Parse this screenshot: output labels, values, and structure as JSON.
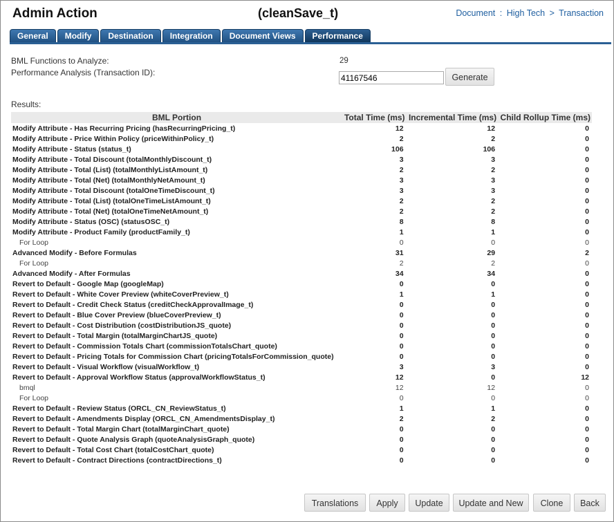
{
  "header": {
    "title": "Admin Action",
    "subtitle": "(cleanSave_t)",
    "breadcrumb": {
      "part1": "Document",
      "sep1": ":",
      "part2": "High Tech",
      "sep2": ">",
      "part3": "Transaction"
    }
  },
  "tabs": [
    "General",
    "Modify",
    "Destination",
    "Integration",
    "Document Views",
    "Performance"
  ],
  "form": {
    "bml_label": "BML Functions to Analyze:",
    "bml_count": "29",
    "perf_label": "Performance Analysis (Transaction ID):",
    "txn_id": "41167546",
    "generate_label": "Generate",
    "results_label": "Results:"
  },
  "table": {
    "headers": [
      "BML Portion",
      "Total Time (ms)",
      "Incremental Time (ms)",
      "Child Rollup Time (ms)"
    ],
    "rows": [
      {
        "level": 0,
        "portion": "Modify Attribute - Has Recurring Pricing (hasRecurringPricing_t)",
        "total": "12",
        "incremental": "12",
        "child": "0"
      },
      {
        "level": 0,
        "portion": "Modify Attribute - Price Within Policy (priceWithinPolicy_t)",
        "total": "2",
        "incremental": "2",
        "child": "0"
      },
      {
        "level": 0,
        "portion": "Modify Attribute - Status (status_t)",
        "total": "106",
        "incremental": "106",
        "child": "0"
      },
      {
        "level": 0,
        "portion": "Modify Attribute - Total Discount (totalMonthlyDiscount_t)",
        "total": "3",
        "incremental": "3",
        "child": "0"
      },
      {
        "level": 0,
        "portion": "Modify Attribute - Total (List) (totalMonthlyListAmount_t)",
        "total": "2",
        "incremental": "2",
        "child": "0"
      },
      {
        "level": 0,
        "portion": "Modify Attribute - Total (Net) (totalMonthlyNetAmount_t)",
        "total": "3",
        "incremental": "3",
        "child": "0"
      },
      {
        "level": 0,
        "portion": "Modify Attribute - Total Discount (totalOneTimeDiscount_t)",
        "total": "3",
        "incremental": "3",
        "child": "0"
      },
      {
        "level": 0,
        "portion": "Modify Attribute - Total (List) (totalOneTimeListAmount_t)",
        "total": "2",
        "incremental": "2",
        "child": "0"
      },
      {
        "level": 0,
        "portion": "Modify Attribute - Total (Net) (totalOneTimeNetAmount_t)",
        "total": "2",
        "incremental": "2",
        "child": "0"
      },
      {
        "level": 0,
        "portion": "Modify Attribute - Status (OSC) (statusOSC_t)",
        "total": "8",
        "incremental": "8",
        "child": "0"
      },
      {
        "level": 0,
        "portion": "Modify Attribute - Product Family (productFamily_t)",
        "total": "1",
        "incremental": "1",
        "child": "0"
      },
      {
        "level": 1,
        "portion": "For Loop",
        "total": "0",
        "incremental": "0",
        "child": "0"
      },
      {
        "level": 0,
        "portion": "Advanced Modify - Before Formulas",
        "total": "31",
        "incremental": "29",
        "child": "2"
      },
      {
        "level": 1,
        "portion": "For Loop",
        "total": "2",
        "incremental": "2",
        "child": "0"
      },
      {
        "level": 0,
        "portion": "Advanced Modify - After Formulas",
        "total": "34",
        "incremental": "34",
        "child": "0"
      },
      {
        "level": 0,
        "portion": "Revert to Default - Google Map (googleMap)",
        "total": "0",
        "incremental": "0",
        "child": "0"
      },
      {
        "level": 0,
        "portion": "Revert to Default - White Cover Preview (whiteCoverPreview_t)",
        "total": "1",
        "incremental": "1",
        "child": "0"
      },
      {
        "level": 0,
        "portion": "Revert to Default - Credit Check Status (creditCheckApprovalImage_t)",
        "total": "0",
        "incremental": "0",
        "child": "0"
      },
      {
        "level": 0,
        "portion": "Revert to Default - Blue Cover Preview (blueCoverPreview_t)",
        "total": "0",
        "incremental": "0",
        "child": "0"
      },
      {
        "level": 0,
        "portion": "Revert to Default - Cost Distribution (costDistributionJS_quote)",
        "total": "0",
        "incremental": "0",
        "child": "0"
      },
      {
        "level": 0,
        "portion": "Revert to Default - Total Margin (totalMarginChartJS_quote)",
        "total": "0",
        "incremental": "0",
        "child": "0"
      },
      {
        "level": 0,
        "portion": "Revert to Default - Commission Totals Chart (commissionTotalsChart_quote)",
        "total": "0",
        "incremental": "0",
        "child": "0"
      },
      {
        "level": 0,
        "portion": "Revert to Default - Pricing Totals for Commission Chart (pricingTotalsForCommission_quote)",
        "total": "0",
        "incremental": "0",
        "child": "0"
      },
      {
        "level": 0,
        "portion": "Revert to Default - Visual Workflow (visualWorkflow_t)",
        "total": "3",
        "incremental": "3",
        "child": "0"
      },
      {
        "level": 0,
        "portion": "Revert to Default - Approval Workflow Status (approvalWorkflowStatus_t)",
        "total": "12",
        "incremental": "0",
        "child": "12"
      },
      {
        "level": 1,
        "portion": "bmql",
        "total": "12",
        "incremental": "12",
        "child": "0"
      },
      {
        "level": 1,
        "portion": "For Loop",
        "total": "0",
        "incremental": "0",
        "child": "0"
      },
      {
        "level": 0,
        "portion": "Revert to Default - Review Status (ORCL_CN_ReviewStatus_t)",
        "total": "1",
        "incremental": "1",
        "child": "0"
      },
      {
        "level": 0,
        "portion": "Revert to Default - Amendments Display (ORCL_CN_AmendmentsDisplay_t)",
        "total": "2",
        "incremental": "2",
        "child": "0"
      },
      {
        "level": 0,
        "portion": "Revert to Default - Total Margin Chart (totalMarginChart_quote)",
        "total": "0",
        "incremental": "0",
        "child": "0"
      },
      {
        "level": 0,
        "portion": "Revert to Default - Quote Analysis Graph (quoteAnalysisGraph_quote)",
        "total": "0",
        "incremental": "0",
        "child": "0"
      },
      {
        "level": 0,
        "portion": "Revert to Default - Total Cost Chart (totalCostChart_quote)",
        "total": "0",
        "incremental": "0",
        "child": "0"
      },
      {
        "level": 0,
        "portion": "Revert to Default - Contract Directions (contractDirections_t)",
        "total": "0",
        "incremental": "0",
        "child": "0"
      }
    ]
  },
  "footer_buttons": [
    "Translations",
    "Apply",
    "Update",
    "Update and New",
    "Clone",
    "Back"
  ],
  "colors": {
    "tab": "#1f4f80",
    "link": "#1f5fa0",
    "header_bg": "#eaeaea"
  }
}
